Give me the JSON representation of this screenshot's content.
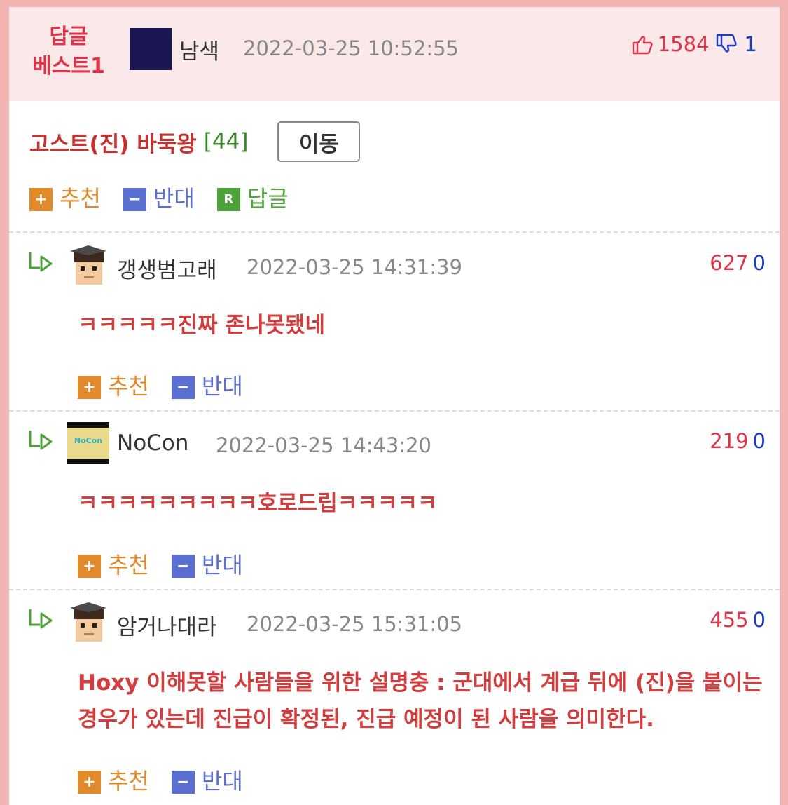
{
  "best": {
    "badge_line1": "답글",
    "badge_line2": "베스트1",
    "author": "남색",
    "date": "2022-03-25 10:52:55",
    "up_count": "1584",
    "down_count": "1"
  },
  "post": {
    "board_name": "고스트(진) 바둑왕",
    "comment_count": "[44]",
    "move_label": "이동",
    "recommend_label": "추천",
    "oppose_label": "반대",
    "reply_label": "답글",
    "reply_icon_letter": "R"
  },
  "icons": {
    "plus": "+",
    "minus": "−"
  },
  "comments": [
    {
      "author": "갱생범고래",
      "date": "2022-03-25 14:31:39",
      "up": "627",
      "down": "0",
      "text": "ㅋㅋㅋㅋㅋ진짜 존나못됐네",
      "recommend_label": "추천",
      "oppose_label": "반대"
    },
    {
      "author": "NoCon",
      "date": "2022-03-25 14:43:20",
      "up": "219",
      "down": "0",
      "text": "ㅋㅋㅋㅋㅋㅋㅋㅋㅋ호로드립ㅋㅋㅋㅋㅋ",
      "recommend_label": "추천",
      "oppose_label": "반대",
      "avatar_text": "NoCon"
    },
    {
      "author": "암거나대라",
      "date": "2022-03-25 15:31:05",
      "up": "455",
      "down": "0",
      "text": "Hoxy 이해못할 사람들을 위한 설명충 : 군대에서 계급 뒤에 (진)을 붙이는 경우가 있는데 진급이 확정된, 진급 예정이 된 사람을 의미한다.",
      "recommend_label": "추천",
      "oppose_label": "반대"
    }
  ],
  "colors": {
    "page_bg": "#f2b3b3",
    "header_bg": "#fbe8e8",
    "accent_red": "#e0334a",
    "down_blue": "#1a3dc8",
    "recommend_orange": "#e08a2c",
    "oppose_blue": "#5a6fd0",
    "reply_green": "#4ea23a"
  }
}
